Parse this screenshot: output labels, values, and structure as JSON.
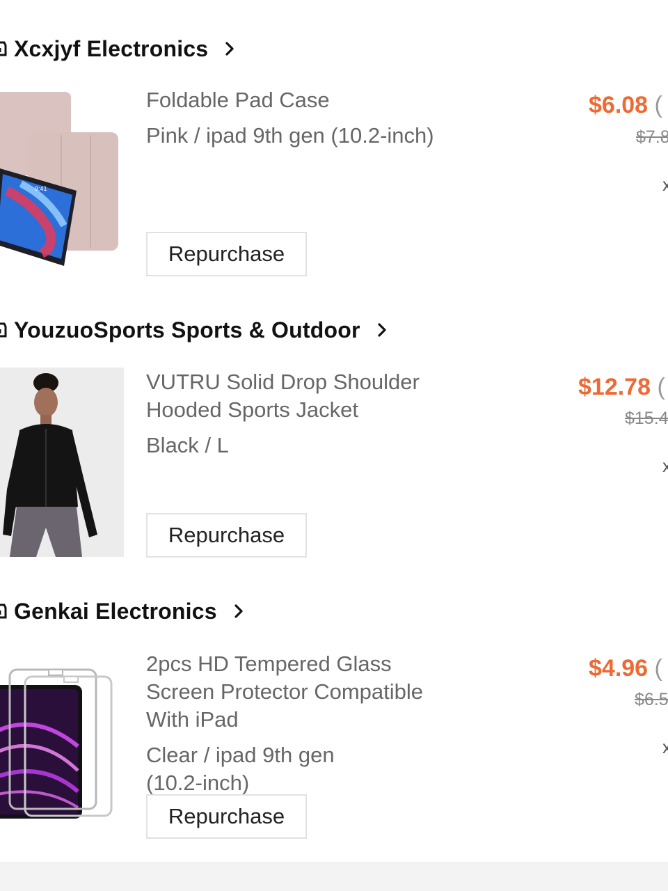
{
  "stores": [
    {
      "name": "Xcxjyf Electronics",
      "product": {
        "title": "Foldable Pad Case",
        "variant": "Pink / ipad 9th gen (10.2-inch)",
        "price": "$6.08",
        "price_suffix": "(",
        "original_price": "$7.8",
        "qty_marker": "x"
      },
      "repurchase_label": "Repurchase"
    },
    {
      "name": "YouzuoSports Sports & Outdoor",
      "product": {
        "title_line1": "VUTRU Solid Drop Shoulder",
        "title_line2": "Hooded Sports Jacket",
        "variant": "Black / L",
        "price": "$12.78",
        "price_suffix": "(",
        "original_price": "$15.4",
        "qty_marker": "x"
      },
      "repurchase_label": "Repurchase"
    },
    {
      "name": "Genkai Electronics",
      "product": {
        "title_line1": "2pcs HD Tempered Glass",
        "title_line2": "Screen Protector Compatible",
        "title_line3": "With iPad",
        "variant_line1": "Clear / ipad 9th gen",
        "variant_line2": "(10.2-inch)",
        "price": "$4.96",
        "price_suffix": "(",
        "original_price": "$6.5",
        "qty_marker": "x"
      },
      "repurchase_label": "Repurchase"
    }
  ],
  "colors": {
    "price": "#ee6a35",
    "text_muted": "#666666",
    "button_border": "#e2e2e2"
  },
  "icons": {
    "store": "store-icon",
    "chevron": "chevron-right-icon"
  }
}
